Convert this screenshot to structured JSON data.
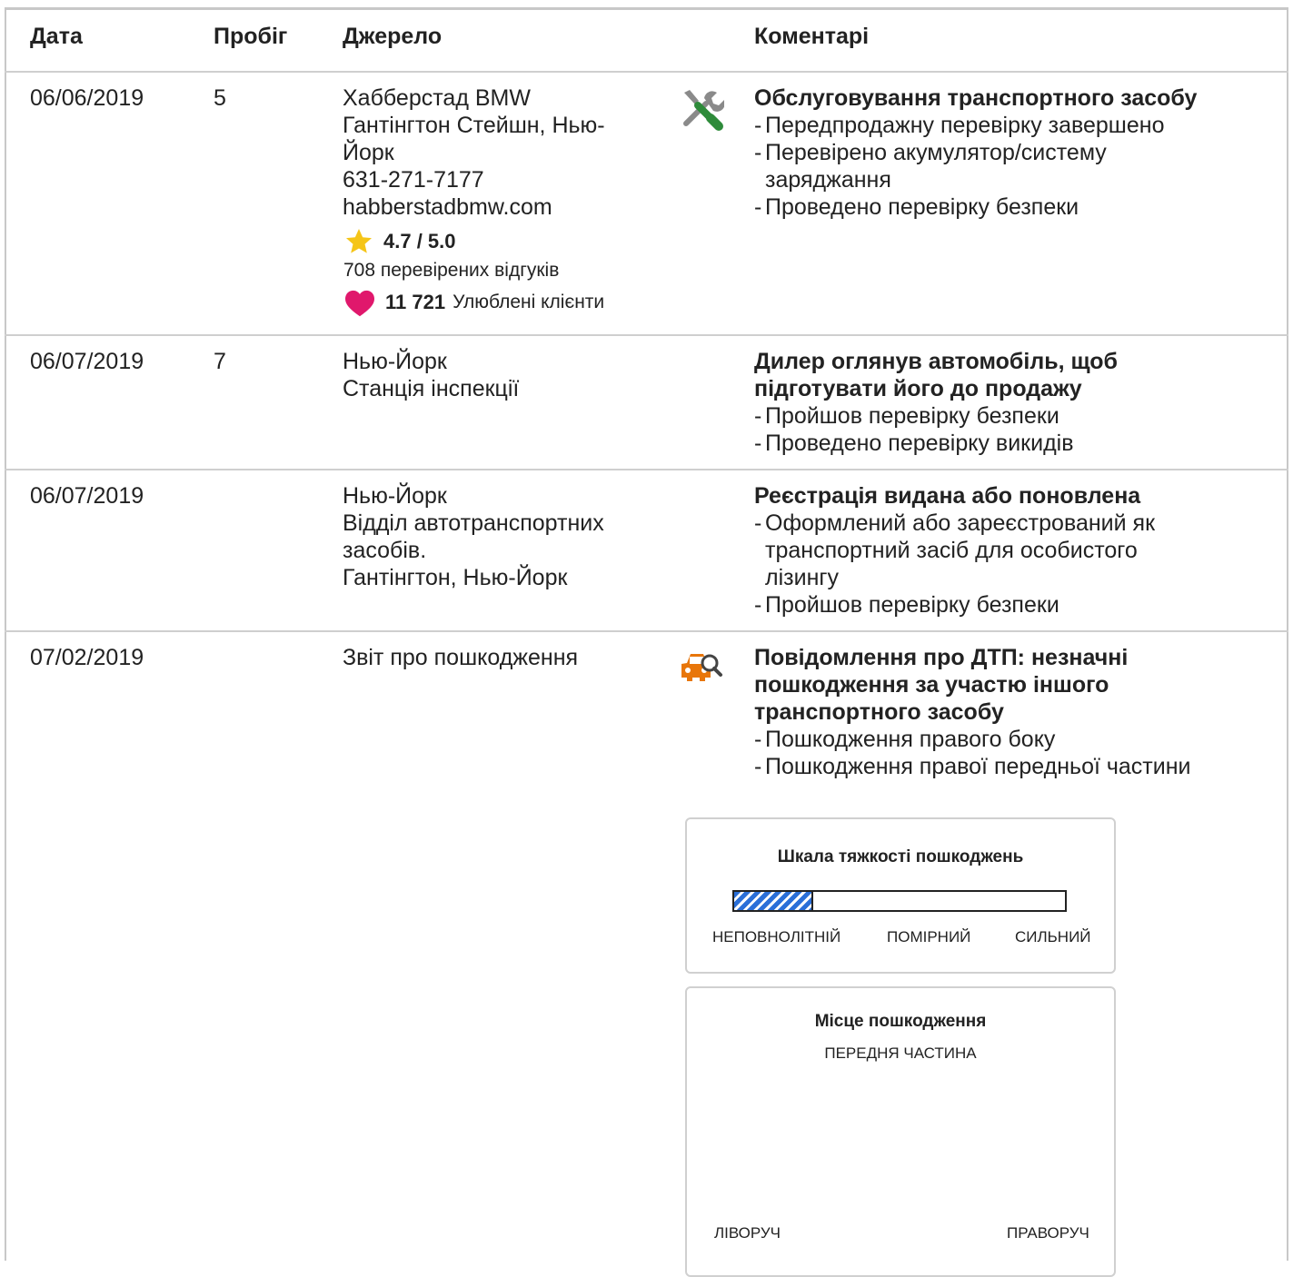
{
  "table": {
    "headers": {
      "date": "Дата",
      "mileage": "Пробіг",
      "source": "Джерело",
      "comments": "Коментарі"
    }
  },
  "rows": [
    {
      "date": "06/06/2019",
      "mileage": "5",
      "source_lines": [
        "Хабберстад BMW",
        "Гантінгтон Стейшн, Нью-",
        "Йорк",
        "631-271-7177",
        "habberstadbmw.com"
      ],
      "rating": "4.7 / 5.0",
      "reviews": "708 перевірених відгуків",
      "favorites_count": "11 721",
      "favorites_label": "Улюблені клієнти",
      "icon": "wrench-screwdriver-icon",
      "comment_title": "Обслуговування транспортного засобу",
      "comment_items": [
        "Передпродажну перевірку завершено",
        "Перевірено акумулятор/систему заряджання",
        "Проведено перевірку безпеки"
      ]
    },
    {
      "date": "06/07/2019",
      "mileage": "7",
      "source_lines": [
        "Нью-Йорк",
        "Станція інспекції"
      ],
      "comment_title_lines": [
        "Дилер оглянув автомобіль, щоб",
        "підготувати його до продажу"
      ],
      "comment_items": [
        "Пройшов перевірку безпеки",
        "Проведено перевірку викидів"
      ]
    },
    {
      "date": "06/07/2019",
      "mileage": "",
      "source_lines": [
        "Нью-Йорк",
        "Відділ автотранспортних",
        "засобів.",
        "Гантінгтон, Нью-Йорк"
      ],
      "comment_title": "Реєстрація видана або поновлена",
      "comment_items": [
        "Оформлений або зареєстрований як транспортний засіб для особистого лізингу",
        "Пройшов перевірку безпеки"
      ]
    },
    {
      "date": "07/02/2019",
      "mileage": "",
      "source_lines": [
        "Звіт про пошкодження"
      ],
      "icon": "car-damage-search-icon",
      "comment_title_lines": [
        "Повідомлення про ДТП: незначні",
        "пошкодження за участю іншого",
        "транспортного засобу"
      ],
      "comment_items": [
        "Пошкодження правого боку",
        "Пошкодження правої передньої частини"
      ]
    }
  ],
  "severity": {
    "title": "Шкала тяжкості пошкоджень",
    "labels": [
      "НЕПОВНОЛІТНІЙ",
      "ПОМІРНИЙ",
      "СИЛЬНИЙ"
    ],
    "level": 0.24,
    "fill_color": "#2a6fd8"
  },
  "location": {
    "title": "Місце пошкодження",
    "front": "ПЕРЕДНЯ ЧАСТИНА",
    "left": "ЛІВОРУЧ",
    "right": "ПРАВОРУЧ"
  },
  "colors": {
    "star": "#f5c518",
    "heart": "#e0186c",
    "wrench_gray": "#8a8a8a",
    "screwdriver_green": "#2e8b3a",
    "car_orange": "#e8760a"
  }
}
